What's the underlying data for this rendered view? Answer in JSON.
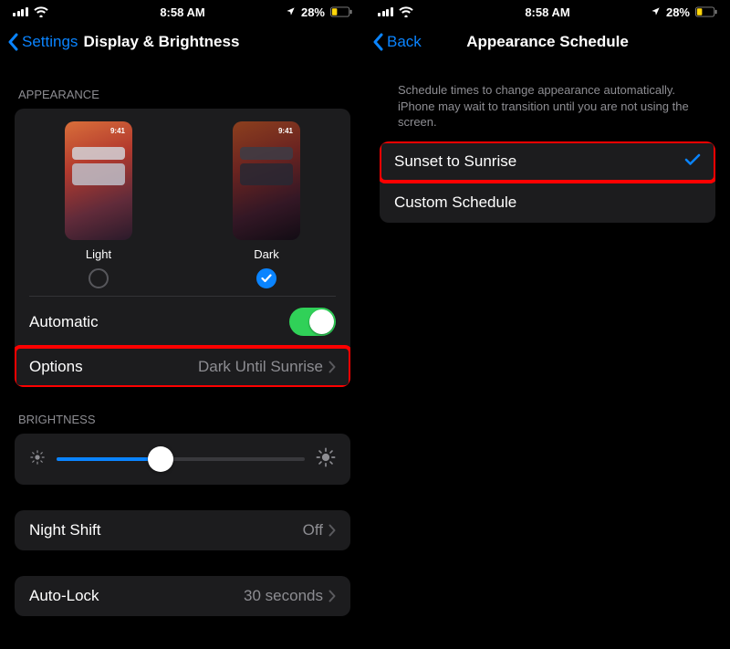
{
  "status": {
    "time": "8:58 AM",
    "battery_text": "28%",
    "loc_icon": "location-icon"
  },
  "left": {
    "back_label": "Settings",
    "title": "Display & Brightness",
    "appearance_header": "APPEARANCE",
    "modes": {
      "light_label": "Light",
      "dark_label": "Dark",
      "preview_time": "9:41",
      "selected": "dark"
    },
    "automatic": {
      "label": "Automatic",
      "on": true
    },
    "options": {
      "label": "Options",
      "value": "Dark Until Sunrise"
    },
    "brightness_header": "BRIGHTNESS",
    "brightness_pct": 42,
    "night_shift": {
      "label": "Night Shift",
      "value": "Off"
    },
    "auto_lock": {
      "label": "Auto-Lock",
      "value": "30 seconds"
    }
  },
  "right": {
    "back_label": "Back",
    "title": "Appearance Schedule",
    "hint": "Schedule times to change appearance automatically. iPhone may wait to transition until you are not using the screen.",
    "opt1": "Sunset to Sunrise",
    "opt2": "Custom Schedule",
    "selected": "opt1"
  },
  "colors": {
    "accent": "#0a84ff",
    "toggle_on": "#30d158",
    "highlight": "#ff0000"
  }
}
